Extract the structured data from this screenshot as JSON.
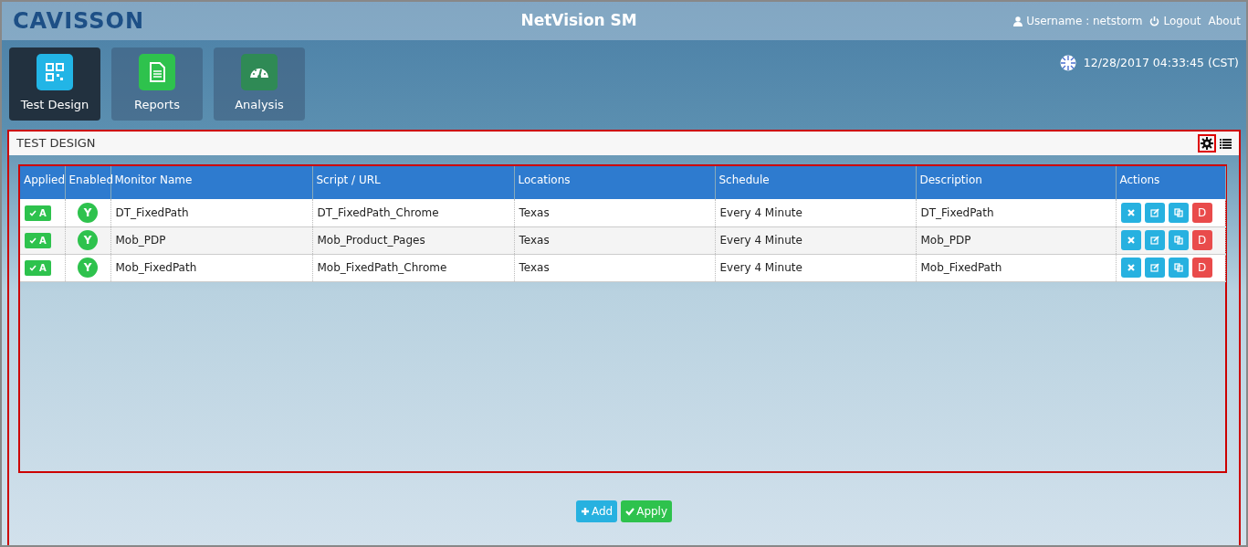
{
  "header": {
    "logo": "CAVISSON",
    "title": "NetVision SM",
    "username": "Username : netstorm",
    "logout": "Logout",
    "about": "About"
  },
  "datetime": "12/28/2017 04:33:45 (CST)",
  "tiles": [
    {
      "label": "Test Design",
      "kind": "design",
      "selected": true
    },
    {
      "label": "Reports",
      "kind": "reports",
      "selected": false
    },
    {
      "label": "Analysis",
      "kind": "analysis",
      "selected": false
    }
  ],
  "panel": {
    "title": "TEST DESIGN"
  },
  "table": {
    "columns": [
      "Applied",
      "Enabled",
      "Monitor Name",
      "Script / URL",
      "Locations",
      "Schedule",
      "Description",
      "Actions"
    ],
    "rows": [
      {
        "applied": "A",
        "enabled": "Y",
        "monitor_name": "DT_FixedPath",
        "script": "DT_FixedPath_Chrome",
        "location": "Texas",
        "schedule": "Every 4 Minute",
        "description": "DT_FixedPath",
        "delete": "D"
      },
      {
        "applied": "A",
        "enabled": "Y",
        "monitor_name": "Mob_PDP",
        "script": "Mob_Product_Pages",
        "location": "Texas",
        "schedule": "Every 4 Minute",
        "description": "Mob_PDP",
        "delete": "D"
      },
      {
        "applied": "A",
        "enabled": "Y",
        "monitor_name": "Mob_FixedPath",
        "script": "Mob_FixedPath_Chrome",
        "location": "Texas",
        "schedule": "Every 4 Minute",
        "description": "Mob_FixedPath",
        "delete": "D"
      }
    ]
  },
  "buttons": [
    {
      "label": "Add",
      "kind": "add"
    },
    {
      "label": "Apply",
      "kind": "apply"
    }
  ]
}
